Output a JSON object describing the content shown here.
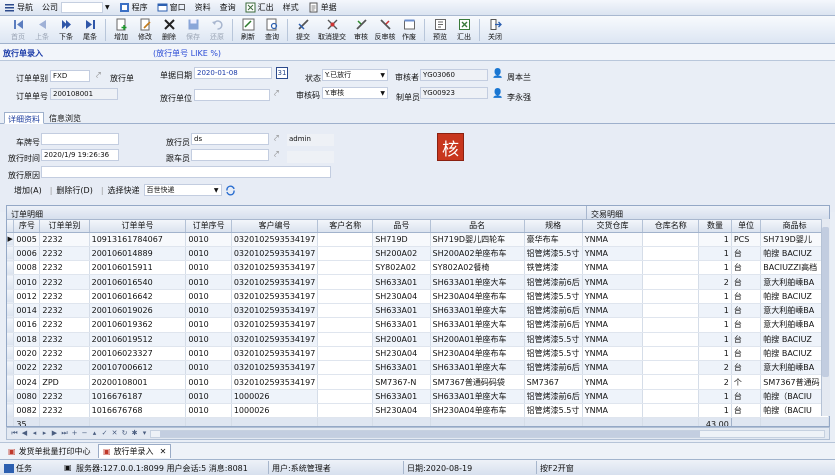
{
  "menu": {
    "nav": "导航",
    "company_label": "公司",
    "items": [
      "程序",
      "窗口",
      "资料",
      "查询",
      "汇出",
      "样式",
      "单据"
    ]
  },
  "toolbar": {
    "first": "首页",
    "prev": "上条",
    "next": "下条",
    "last": "尾条",
    "add": "增加",
    "edit": "修改",
    "delete": "删除",
    "save": "保存",
    "cancel_edit": "还原",
    "refresh": "刷新",
    "query": "查询",
    "submit": "提交",
    "cancel_submit": "取消提交",
    "audit": "审核",
    "unaudit": "反审核",
    "void": "作废",
    "preview": "预览",
    "export": "汇出",
    "close": "关闭"
  },
  "page": {
    "title": "放行单录入",
    "subtitle": "(放行单号 LIKE %)"
  },
  "form": {
    "order_type_label": "订单单别",
    "order_type": "FXD",
    "release_note_label": "放行单",
    "order_no_label": "订单单号",
    "order_no": "200108001",
    "doc_date_label": "单据日期",
    "doc_date": "2020-01-08",
    "calendar_day": "31",
    "release_unit_label": "放行单位",
    "release_unit": "",
    "status_label": "状态",
    "status": "Y.已放行",
    "audit_code_label": "审核码",
    "audit_code": "Y.审核",
    "auditor_label": "审核者",
    "auditor_id": "YG03060",
    "auditor_name": "周本兰",
    "maker_label": "制单员",
    "maker_id": "YG00923",
    "maker_name": "李永强"
  },
  "tabs": [
    "详细资料",
    "信息浏览"
  ],
  "detail": {
    "plate_label": "车牌号",
    "plate": "",
    "releaser_label": "放行员",
    "releaser": "ds",
    "releaser_name": "admin",
    "release_time_label": "放行时间",
    "release_time": "2020/1/9 19:26:36",
    "follower_label": "跟车员",
    "follower": "",
    "reason_label": "放行原因",
    "reason": "",
    "badge": "核"
  },
  "actions": {
    "add_row": "增加(A)",
    "delete_row": "删除行(D)",
    "quick_label": "选择快递",
    "quick_value": "百世快递"
  },
  "grid": {
    "group_order": "订单明细",
    "group_trade": "交易明细",
    "columns": [
      "序号",
      "订单单别",
      "订单单号",
      "订单序号",
      "客户编号",
      "客户名称",
      "品号",
      "品名",
      "规格",
      "交货仓库",
      "仓库名称",
      "数量",
      "单位",
      "商品标"
    ],
    "rows": [
      [
        "0005",
        "2232",
        "10913161784067",
        "0010",
        "0320102593534197",
        "",
        "SH719D",
        "SH719D婴儿四轮车",
        "豪华布车",
        "YNMA",
        "",
        "1",
        "PCS",
        "SH719D婴儿"
      ],
      [
        "0006",
        "2232",
        "200106014889",
        "0010",
        "0320102593534197",
        "",
        "SH200A02",
        "SH200A02单座布车",
        "铝管烤漆5.5寸",
        "YNMA",
        "",
        "1",
        "台",
        "帕搜 BACIUZ"
      ],
      [
        "0008",
        "2232",
        "200106015911",
        "0010",
        "0320102593534197",
        "",
        "SY802A02",
        "SY802A02餐椅",
        "铁管烤漆",
        "YNMA",
        "",
        "1",
        "台",
        "BACIUZZI高档"
      ],
      [
        "0010",
        "2232",
        "200106016540",
        "0010",
        "0320102593534197",
        "",
        "SH633A01",
        "SH633A01单座大车",
        "铝管烤漆前6后",
        "YNMA",
        "",
        "2",
        "台",
        "意大利舶嵊BA"
      ],
      [
        "0012",
        "2232",
        "200106016642",
        "0010",
        "0320102593534197",
        "",
        "SH230A04",
        "SH230A04单座布车",
        "铝管烤漆5.5寸",
        "YNMA",
        "",
        "1",
        "台",
        "帕搜 BACIUZ"
      ],
      [
        "0014",
        "2232",
        "200106019026",
        "0010",
        "0320102593534197",
        "",
        "SH633A01",
        "SH633A01单座大车",
        "铝管烤漆前6后",
        "YNMA",
        "",
        "1",
        "台",
        "意大利舶嵊BA"
      ],
      [
        "0016",
        "2232",
        "200106019362",
        "0010",
        "0320102593534197",
        "",
        "SH633A01",
        "SH633A01单座大车",
        "铝管烤漆前6后",
        "YNMA",
        "",
        "1",
        "台",
        "意大利舶嵊BA"
      ],
      [
        "0018",
        "2232",
        "200106019512",
        "0010",
        "0320102593534197",
        "",
        "SH200A01",
        "SH200A01单座布车",
        "铝管烤漆5.5寸",
        "YNMA",
        "",
        "1",
        "台",
        "帕搜 BACIUZ"
      ],
      [
        "0020",
        "2232",
        "200106023327",
        "0010",
        "0320102593534197",
        "",
        "SH230A04",
        "SH230A04单座布车",
        "铝管烤漆5.5寸",
        "YNMA",
        "",
        "1",
        "台",
        "帕搜 BACIUZ"
      ],
      [
        "0022",
        "2232",
        "200107006612",
        "0010",
        "0320102593534197",
        "",
        "SH633A01",
        "SH633A01单座大车",
        "铝管烤漆前6后",
        "YNMA",
        "",
        "2",
        "台",
        "意大利舶嵊BA"
      ],
      [
        "0024",
        "ZPD",
        "20200108001",
        "0010",
        "0320102593534197",
        "",
        "SM7367-N",
        "SM7367普通码码袋",
        "SM7367",
        "YNMA",
        "",
        "2",
        "个",
        "SM7367普通码"
      ],
      [
        "0080",
        "2232",
        "1016676187",
        "0010",
        "1000026",
        "",
        "SH633A01",
        "SH633A01单座大车",
        "铝管烤漆前6后",
        "YNMA",
        "",
        "1",
        "台",
        "帕搜（BACIU"
      ],
      [
        "0082",
        "2232",
        "1016676768",
        "0010",
        "1000026",
        "",
        "SH230A04",
        "SH230A04单座布车",
        "铝管烤漆5.5寸",
        "YNMA",
        "",
        "1",
        "台",
        "帕搜（BACIU"
      ]
    ],
    "footer_count": "35",
    "footer_qty": "43.00"
  },
  "doc_tabs": [
    "发货单批量打印中心",
    "放行单录入"
  ],
  "status": {
    "task": "任务",
    "server": "服务器:127.0.0.1:8099 用户会话:5 消息:8081",
    "user": "用户:系统管理者",
    "date": "日期:2020-08-19",
    "hint": "按F2开窗"
  }
}
